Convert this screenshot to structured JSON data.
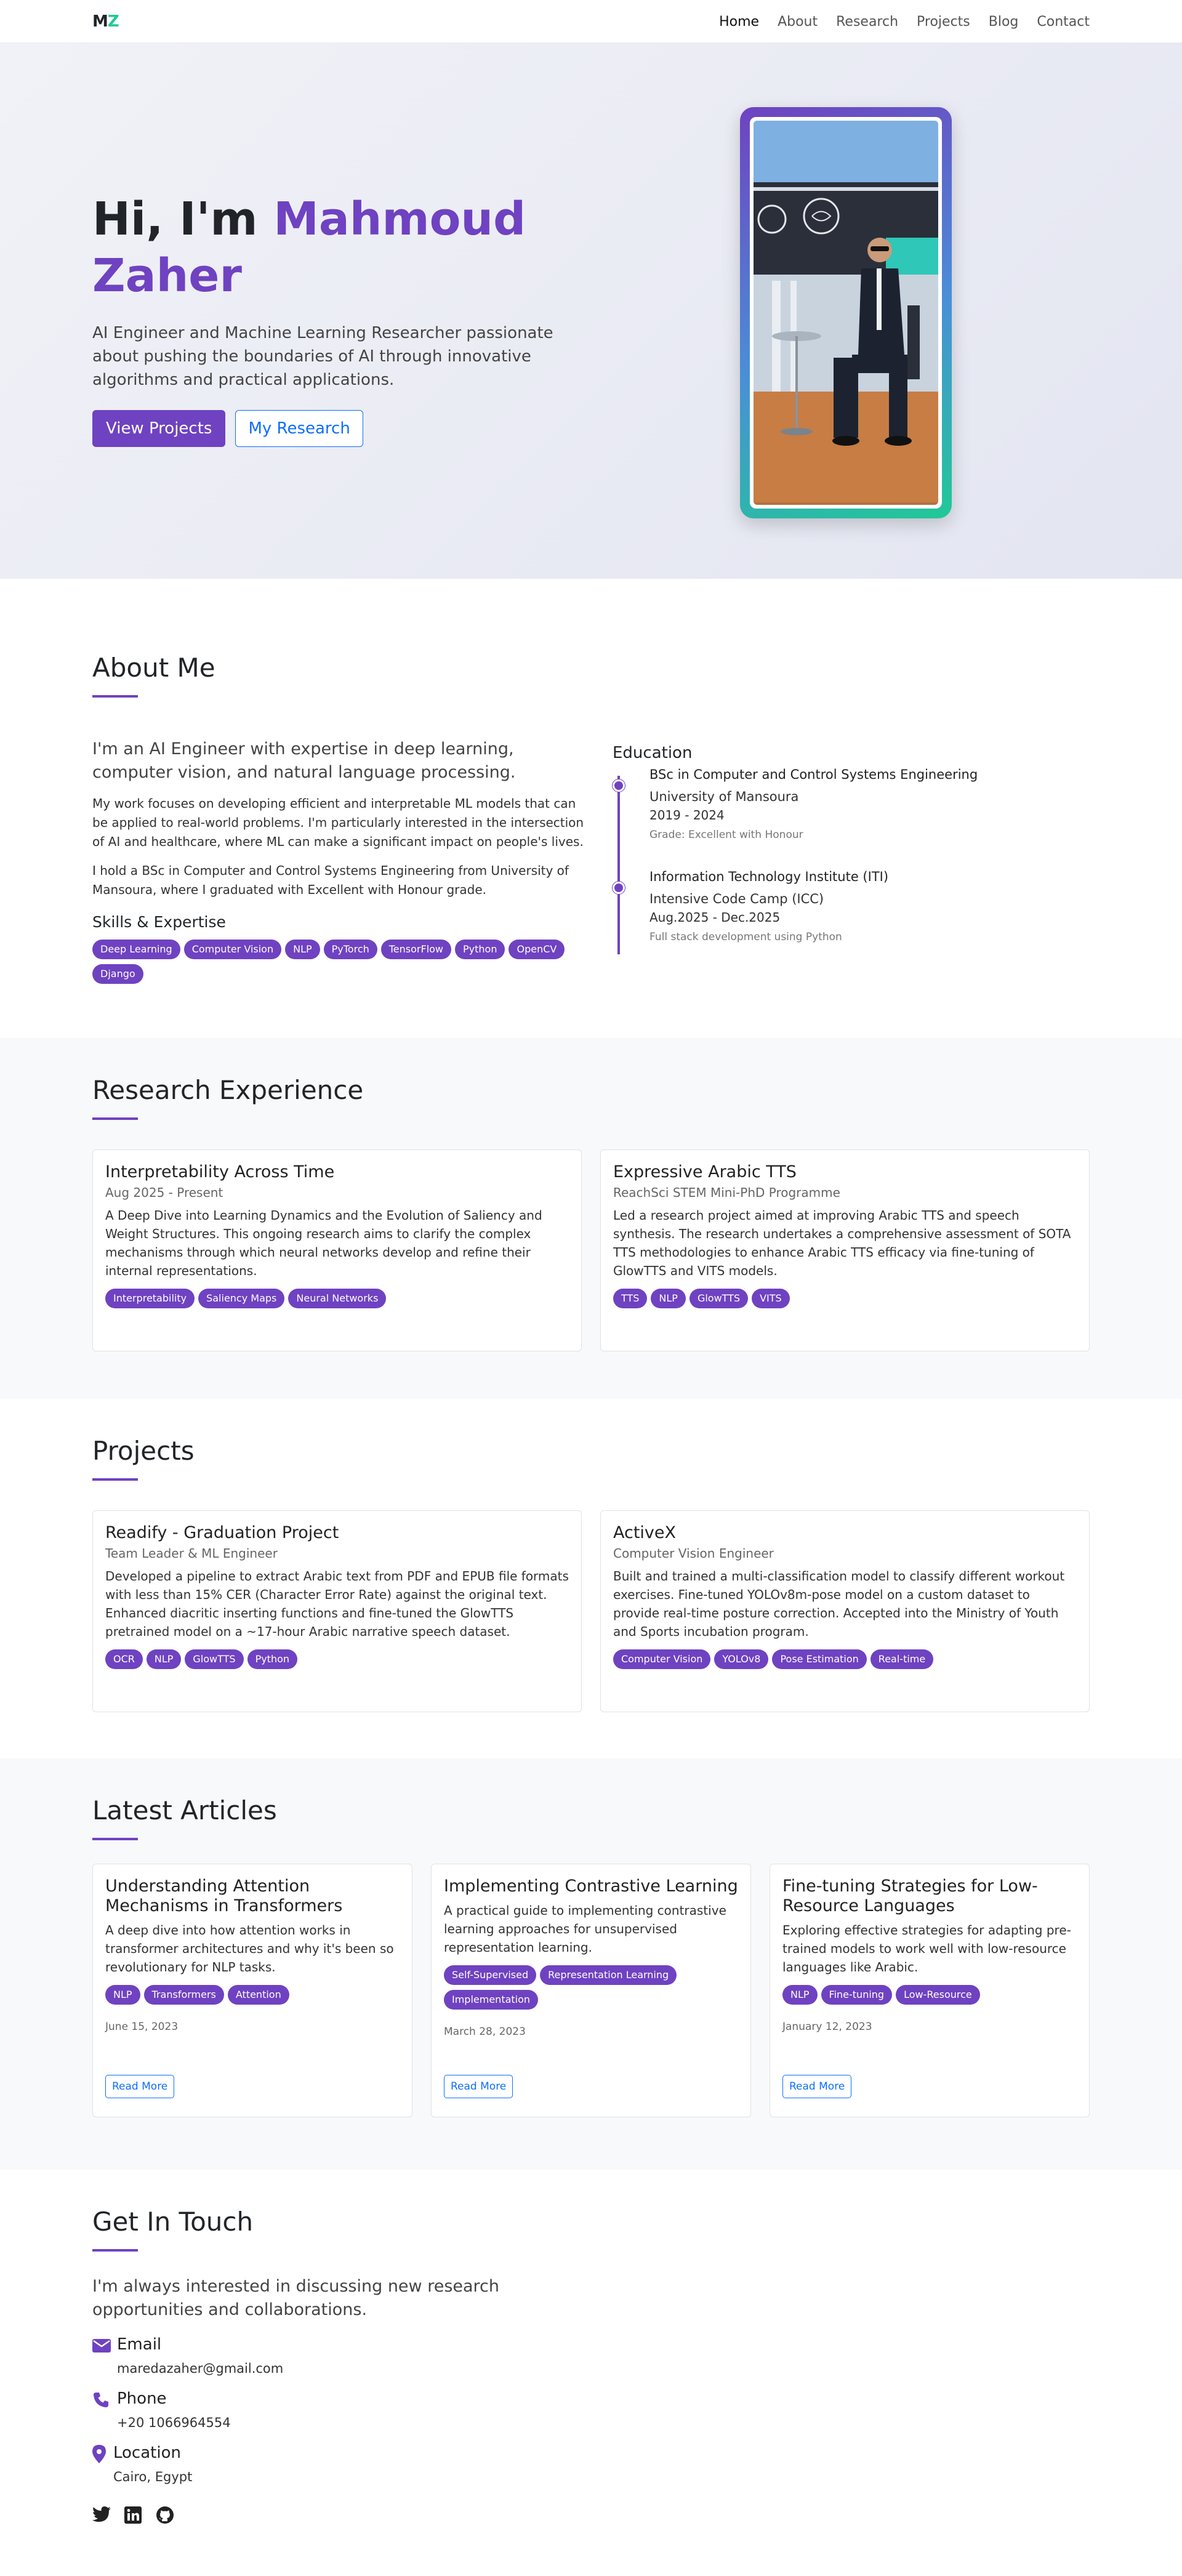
{
  "nav": {
    "logo_m": "M",
    "logo_z": "Z",
    "links": [
      "Home",
      "About",
      "Research",
      "Projects",
      "Blog",
      "Contact"
    ]
  },
  "hero": {
    "greeting": "Hi, I'm",
    "name_line1": "Mahmoud",
    "name_line2": "Zaher",
    "description": "AI Engineer and Machine Learning Researcher passionate about pushing the boundaries of AI through innovative algorithms and practical applications.",
    "btn_projects": "View Projects",
    "btn_research": "My Research"
  },
  "about": {
    "title": "About Me",
    "lead": "I'm an AI Engineer with expertise in deep learning, computer vision, and natural language processing.",
    "p1": "My work focuses on developing efficient and interpretable ML models that can be applied to real-world problems. I'm particularly interested in the intersection of AI and healthcare, where ML can make a significant impact on people's lives.",
    "p2": "I hold a BSc in Computer and Control Systems Engineering from University of Mansoura, where I graduated with Excellent with Honour grade.",
    "skills_title": "Skills & Expertise",
    "skills": [
      "Deep Learning",
      "Computer Vision",
      "NLP",
      "PyTorch",
      "TensorFlow",
      "Python",
      "OpenCV",
      "Django"
    ],
    "education_title": "Education",
    "education": [
      {
        "degree": "BSc in Computer and Control Systems Engineering",
        "org": "University of Mansoura",
        "years": "2019 - 2024",
        "note": "Grade: Excellent with Honour"
      },
      {
        "degree": "Information Technology Institute (ITI)",
        "org": "Intensive Code Camp (ICC)",
        "years": "Aug.2025 - Dec.2025",
        "note": "Full stack development using Python"
      }
    ]
  },
  "research": {
    "title": "Research Experience",
    "items": [
      {
        "title": "Interpretability Across Time",
        "sub": "Aug 2025 - Present",
        "body": "A Deep Dive into Learning Dynamics and the Evolution of Saliency and Weight Structures. This ongoing research aims to clarify the complex mechanisms through which neural networks develop and refine their internal representations.",
        "tags": [
          "Interpretability",
          "Saliency Maps",
          "Neural Networks"
        ]
      },
      {
        "title": "Expressive Arabic TTS",
        "sub": "ReachSci STEM Mini-PhD Programme",
        "body": "Led a research project aimed at improving Arabic TTS and speech synthesis. The research undertakes a comprehensive assessment of SOTA TTS methodologies to enhance Arabic TTS efficacy via fine-tuning of GlowTTS and VITS models.",
        "tags": [
          "TTS",
          "NLP",
          "GlowTTS",
          "VITS"
        ]
      }
    ]
  },
  "projects": {
    "title": "Projects",
    "items": [
      {
        "title": "Readify - Graduation Project",
        "sub": "Team Leader & ML Engineer",
        "body": "Developed a pipeline to extract Arabic text from PDF and EPUB file formats with less than 15% CER (Character Error Rate) against the original text. Enhanced diacritic inserting functions and fine-tuned the GlowTTS pretrained model on a ~17-hour Arabic narrative speech dataset.",
        "tags": [
          "OCR",
          "NLP",
          "GlowTTS",
          "Python"
        ]
      },
      {
        "title": "ActiveX",
        "sub": "Computer Vision Engineer",
        "body": "Built and trained a multi-classification model to classify different workout exercises. Fine-tuned YOLOv8m-pose model on a custom dataset to provide real-time posture correction. Accepted into the Ministry of Youth and Sports incubation program.",
        "tags": [
          "Computer Vision",
          "YOLOv8",
          "Pose Estimation",
          "Real-time"
        ]
      }
    ]
  },
  "articles": {
    "title": "Latest Articles",
    "read_more": "Read More",
    "items": [
      {
        "title": "Understanding Attention Mechanisms in Transformers",
        "body": "A deep dive into how attention works in transformer architectures and why it's been so revolutionary for NLP tasks.",
        "tags": [
          "NLP",
          "Transformers",
          "Attention"
        ],
        "date": "June 15, 2023"
      },
      {
        "title": "Implementing Contrastive Learning",
        "body": "A practical guide to implementing contrastive learning approaches for unsupervised representation learning.",
        "tags": [
          "Self-Supervised",
          "Representation Learning",
          "Implementation"
        ],
        "date": "March 28, 2023"
      },
      {
        "title": "Fine-tuning Strategies for Low-Resource Languages",
        "body": "Exploring effective strategies for adapting pre-trained models to work well with low-resource languages like Arabic.",
        "tags": [
          "NLP",
          "Fine-tuning",
          "Low-Resource"
        ],
        "date": "January 12, 2023"
      }
    ]
  },
  "contact": {
    "title": "Get In Touch",
    "lead": "I'm always interested in discussing new research opportunities and collaborations.",
    "email_label": "Email",
    "email": "maredazaher@gmail.com",
    "phone_label": "Phone",
    "phone": "+20 1066964554",
    "location_label": "Location",
    "location": "Cairo, Egypt"
  },
  "colors": {
    "accent": "#6f42c1",
    "teal": "#20c997",
    "link": "#0d6efd"
  }
}
